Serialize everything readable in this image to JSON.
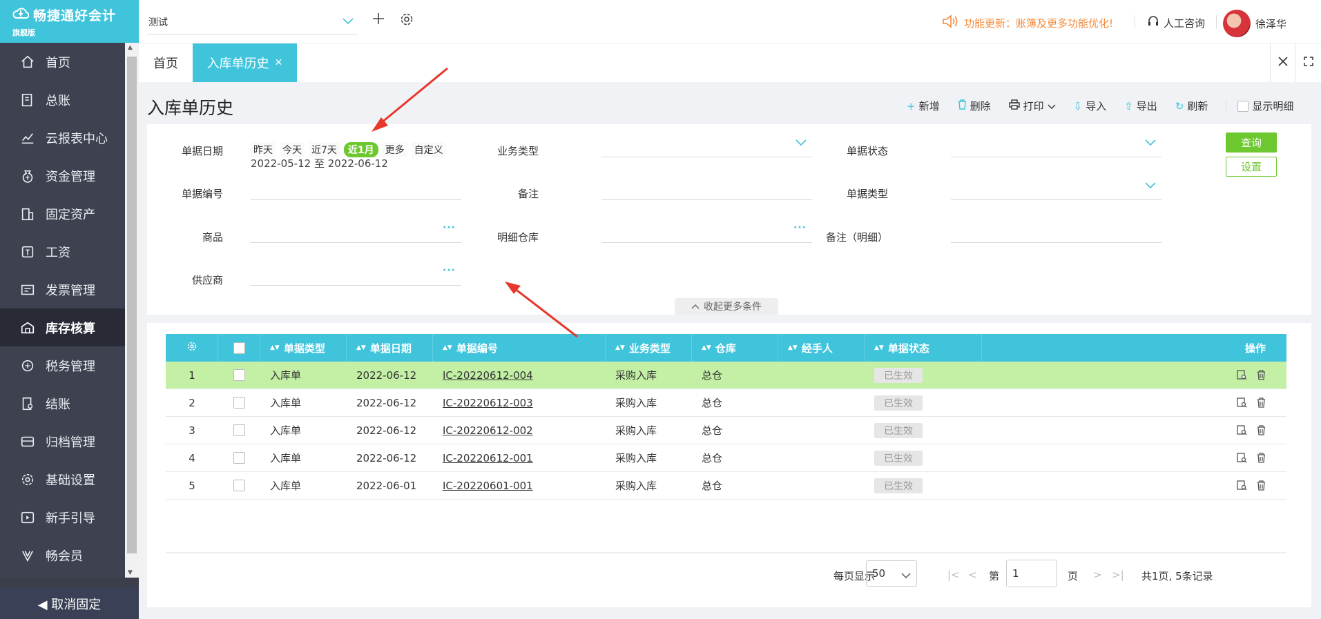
{
  "app": {
    "brand": "畅捷通好会计",
    "edition": "旗舰版",
    "unpin_label": "◀ 取消固定"
  },
  "sidebar": {
    "items": [
      {
        "label": "首页",
        "icon": "home-icon"
      },
      {
        "label": "总账",
        "icon": "ledger-icon"
      },
      {
        "label": "云报表中心",
        "icon": "chart-icon"
      },
      {
        "label": "资金管理",
        "icon": "money-bag-icon"
      },
      {
        "label": "固定资产",
        "icon": "building-icon"
      },
      {
        "label": "工资",
        "icon": "salary-icon"
      },
      {
        "label": "发票管理",
        "icon": "invoice-icon"
      },
      {
        "label": "库存核算",
        "icon": "warehouse-icon",
        "active": true
      },
      {
        "label": "税务管理",
        "icon": "tax-icon"
      },
      {
        "label": "结账",
        "icon": "checkout-icon"
      },
      {
        "label": "归档管理",
        "icon": "archive-icon"
      },
      {
        "label": "基础设置",
        "icon": "gear-icon"
      },
      {
        "label": "新手引导",
        "icon": "video-icon"
      },
      {
        "label": "畅会员",
        "icon": "vip-icon"
      }
    ]
  },
  "topbar": {
    "account": "测试",
    "notice": "功能更新：账簿及更多功能优化!",
    "consult": "人工咨询",
    "username": "徐泽华"
  },
  "tabs": {
    "home": "首页",
    "current": "入库单历史"
  },
  "page": {
    "title": "入库单历史"
  },
  "toolbar": {
    "add": "新增",
    "delete": "删除",
    "print": "打印",
    "import": "导入",
    "export": "导出",
    "refresh": "刷新",
    "show_detail": "显示明细"
  },
  "filter": {
    "date_label": "单据日期",
    "date_options": [
      "昨天",
      "今天",
      "近7天",
      "近1月",
      "更多",
      "自定义"
    ],
    "date_active": "近1月",
    "date_range": "2022-05-12 至 2022-06-12",
    "biz_type_label": "业务类型",
    "status_label": "单据状态",
    "doc_no_label": "单据编号",
    "remark_label": "备注",
    "doc_type_label": "单据类型",
    "product_label": "商品",
    "detail_wh_label": "明细仓库",
    "detail_remark_label": "备注（明细）",
    "supplier_label": "供应商",
    "query": "查询",
    "settings": "设置",
    "collapse": "收起更多条件"
  },
  "table": {
    "headers": {
      "type": "单据类型",
      "date": "单据日期",
      "no": "单据编号",
      "biz": "业务类型",
      "wh": "仓库",
      "handler": "经手人",
      "status": "单据状态",
      "op": "操作"
    },
    "rows": [
      {
        "idx": "1",
        "type": "入库单",
        "date": "2022-06-12",
        "no": "IC-20220612-004",
        "biz": "采购入库",
        "wh": "总仓",
        "handler": "",
        "status": "已生效"
      },
      {
        "idx": "2",
        "type": "入库单",
        "date": "2022-06-12",
        "no": "IC-20220612-003",
        "biz": "采购入库",
        "wh": "总仓",
        "handler": "",
        "status": "已生效"
      },
      {
        "idx": "3",
        "type": "入库单",
        "date": "2022-06-12",
        "no": "IC-20220612-002",
        "biz": "采购入库",
        "wh": "总仓",
        "handler": "",
        "status": "已生效"
      },
      {
        "idx": "4",
        "type": "入库单",
        "date": "2022-06-12",
        "no": "IC-20220612-001",
        "biz": "采购入库",
        "wh": "总仓",
        "handler": "",
        "status": "已生效"
      },
      {
        "idx": "5",
        "type": "入库单",
        "date": "2022-06-01",
        "no": "IC-20220601-001",
        "biz": "采购入库",
        "wh": "总仓",
        "handler": "",
        "status": "已生效"
      }
    ]
  },
  "pager": {
    "per_page_label": "每页显示",
    "per_page": "50",
    "page_prefix": "第",
    "page": "1",
    "page_suffix": "页",
    "summary": "共1页, 5条记录"
  },
  "colors": {
    "accent": "#3fc4dc",
    "green": "#6dc72e",
    "highlight_row": "#c3f0a5",
    "sidebar_bg": "#3d4150",
    "annotation_red": "#e8372c"
  }
}
